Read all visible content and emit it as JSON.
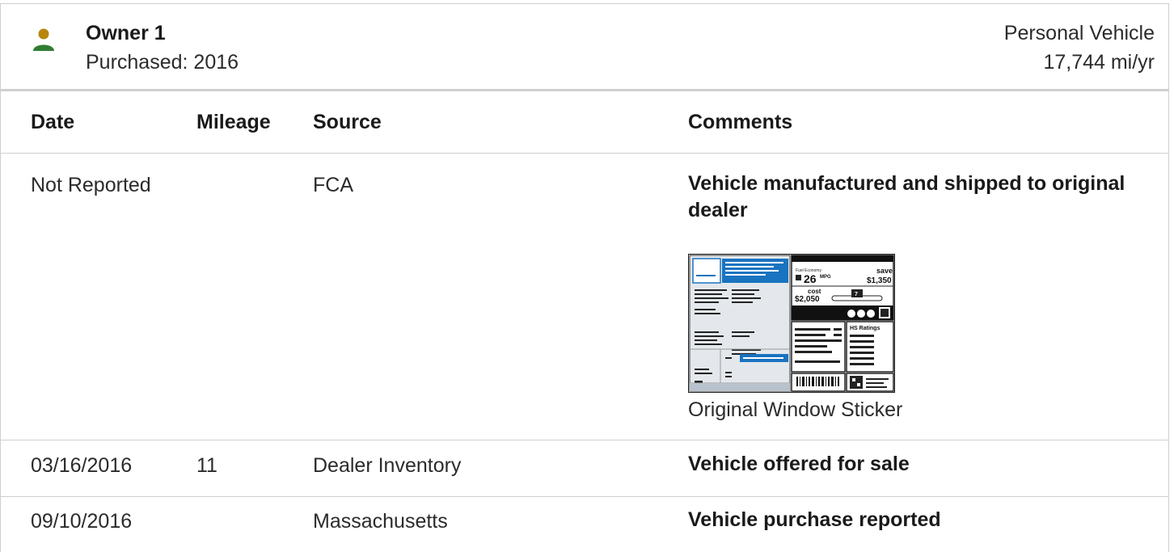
{
  "owner": {
    "name": "Owner 1",
    "purchased": "Purchased: 2016",
    "vehicle_type": "Personal Vehicle",
    "annual_mileage": "17,744 mi/yr",
    "avatar_icon": "person-icon",
    "avatar_head_color": "#b8860b",
    "avatar_body_color": "#2e7d32"
  },
  "table": {
    "headers": [
      "Date",
      "Mileage",
      "Source",
      "Comments"
    ],
    "rows": [
      {
        "date": "Not Reported",
        "mileage": "",
        "source": "FCA",
        "comment": "Vehicle manufactured and shipped to original dealer",
        "attachment_label": "Original Window Sticker"
      },
      {
        "date": "03/16/2016",
        "mileage": "11",
        "source": "Dealer Inventory",
        "comment": "Vehicle offered for sale"
      },
      {
        "date": "09/10/2016",
        "mileage": "",
        "source": "Massachusetts",
        "comment": "Vehicle purchase reported"
      }
    ]
  },
  "sticker": {
    "mpg_label": "Fuel Economy",
    "mpg_value": "26",
    "mpg_unit": "MPG",
    "save_label": "You save",
    "save_word": "save",
    "save_value": "$1,350",
    "cost_label": "Annual fuel cost",
    "cost_value": "$2,050",
    "cost_word": "cost",
    "rating_value": "7",
    "ratings_title": "HS Ratings",
    "accent_color": "#1a73c0"
  }
}
